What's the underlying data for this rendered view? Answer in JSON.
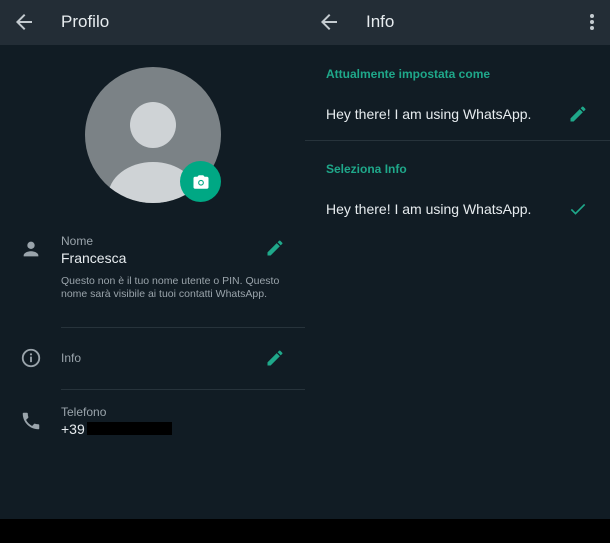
{
  "profile": {
    "header": {
      "title": "Profilo",
      "back_icon": "arrow-left-icon"
    },
    "avatar": {
      "icon": "default-user-avatar",
      "camera_icon": "camera-icon"
    },
    "name": {
      "icon": "person-icon",
      "label": "Nome",
      "value": "Francesca",
      "hint": "Questo non è il tuo nome utente o PIN. Questo nome sarà visibile ai tuoi contatti WhatsApp.",
      "edit_icon": "pencil-icon"
    },
    "about": {
      "icon": "info-icon",
      "label": "Info",
      "edit_icon": "pencil-icon"
    },
    "phone": {
      "icon": "phone-icon",
      "label": "Telefono",
      "value": "+39"
    }
  },
  "info": {
    "header": {
      "title": "Info",
      "back_icon": "arrow-left-icon",
      "menu_icon": "more-vert-icon"
    },
    "current": {
      "section_label": "Attualmente impostata come",
      "value": "Hey there! I am using WhatsApp.",
      "edit_icon": "pencil-icon"
    },
    "select": {
      "section_label": "Seleziona Info",
      "options": [
        {
          "label": "Hey there! I am using WhatsApp.",
          "selected": true
        }
      ]
    }
  },
  "colors": {
    "accent": "#00a884",
    "accent_text": "#1fa88a",
    "header_bg": "#232d36",
    "body_bg": "#111c24"
  }
}
